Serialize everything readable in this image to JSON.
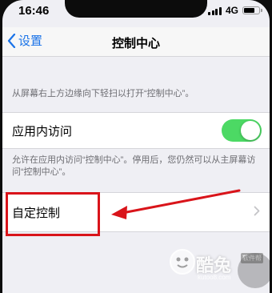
{
  "status_bar": {
    "time": "16:46",
    "network": "4G",
    "battery_level": 0.75,
    "icons": [
      "signal-icon",
      "battery-icon"
    ]
  },
  "nav": {
    "back_label": "设置",
    "title": "控制中心"
  },
  "description_top": "从屏幕右上方边缘向下轻扫以打开“控制中心”。",
  "access_row": {
    "label": "应用内访问",
    "toggle_on": true,
    "toggle_color": "#4cd964"
  },
  "description_access": "允许在应用内访问“控制中心”。停用后，您仍然可以从主屏幕访问“控制中心”。",
  "custom_row": {
    "label": "自定控制"
  },
  "annotation": {
    "color": "#d9141a"
  },
  "watermark": {
    "name": "酷兔",
    "badge": "软件帮",
    "url": "kutoo8.com"
  }
}
